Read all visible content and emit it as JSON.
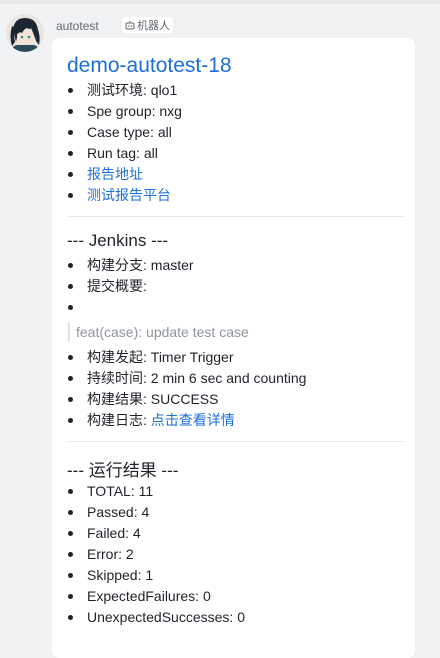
{
  "message": {
    "sender_name": "autotest",
    "robot_badge": "机器人",
    "avatar_icon": "anime-character-avatar"
  },
  "card": {
    "title": "demo-autotest-18",
    "info_items": [
      {
        "label": "测试环境",
        "value": "qlo1"
      },
      {
        "label": "Spe group",
        "value": "nxg"
      },
      {
        "label": "Case type",
        "value": "all"
      },
      {
        "label": "Run tag",
        "value": "all"
      }
    ],
    "report_link": "报告地址",
    "report_platform_link": "测试报告平台",
    "jenkins": {
      "section_title": "--- Jenkins ---",
      "branch_label": "构建分支",
      "branch_value": "master",
      "commit_label": "提交概要",
      "commit_quote": "feat(case): update test case",
      "trigger_label": "构建发起",
      "trigger_value": "Timer Trigger",
      "duration_label": "持续时间",
      "duration_value": "2 min 6 sec and counting",
      "result_label": "构建结果",
      "result_value": "SUCCESS",
      "log_label": "构建日志",
      "log_link": "点击查看详情"
    },
    "results": {
      "section_title": "--- 运行结果 ---",
      "items": [
        {
          "label": "TOTAL",
          "value": "11"
        },
        {
          "label": "Passed",
          "value": "4"
        },
        {
          "label": "Failed",
          "value": "4"
        },
        {
          "label": "Error",
          "value": "2"
        },
        {
          "label": "Skipped",
          "value": "1"
        },
        {
          "label": "ExpectedFailures",
          "value": "0"
        },
        {
          "label": "UnexpectedSuccesses",
          "value": "0"
        }
      ]
    }
  },
  "colors": {
    "link": "#1e6fd9",
    "text": "#1f2329",
    "muted": "#8f959e",
    "background": "#f1f2f4",
    "card": "#ffffff"
  }
}
